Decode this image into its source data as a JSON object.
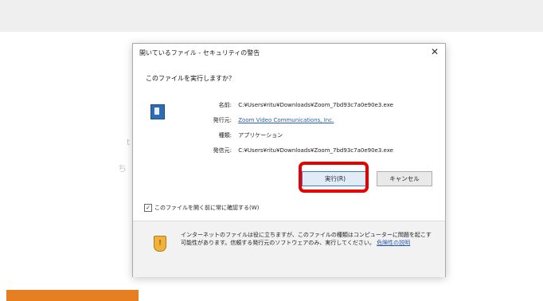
{
  "dialog": {
    "title": "開いているファイル - セキュリティの警告",
    "close_glyph": "✕",
    "question": "このファイルを実行しますか？",
    "fields": {
      "name": {
        "label": "名前:",
        "value": "C:¥Users¥ritu¥Downloads¥Zoom_7bd93c7a0e90e3.exe"
      },
      "publisher": {
        "label": "発行元:",
        "value": "Zoom Video Communications, Inc."
      },
      "type": {
        "label": "種類:",
        "value": "アプリケーション"
      },
      "from": {
        "label": "発信元:",
        "value": "C:¥Users¥ritu¥Downloads¥Zoom_7bd93c7a0e90e3.exe"
      }
    },
    "run_button": "実行(R)",
    "cancel_button": "キャンセル",
    "checkbox_label": "このファイルを開く前に常に確認する(W)",
    "warning_text": "インターネットのファイルは役に立ちますが、このファイルの種類はコンピューターに問題を起こす可能性があります。信頼する発行元のソフトウェアのみ、実行してください。",
    "risk_link": "危険性の説明",
    "checkbox_checked": true
  },
  "background": {
    "glyph_left_1": "t",
    "glyph_left_2": "ち"
  },
  "colors": {
    "highlight": "#e60000",
    "accent_orange": "#e67e22"
  },
  "icons": {
    "file": "app-file-icon",
    "warning": "shield-warning-icon"
  }
}
